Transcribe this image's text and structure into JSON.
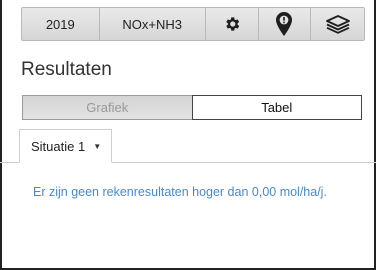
{
  "toolbar": {
    "year_label": "2019",
    "substance_label": "NOx+NH3",
    "icons": [
      "gear-icon",
      "map-marker-icon",
      "layers-icon"
    ]
  },
  "page": {
    "title": "Resultaten"
  },
  "view_toggle": {
    "options": [
      "Grafiek",
      "Tabel"
    ],
    "selected": "Tabel"
  },
  "tabs": {
    "active_label": "Situatie 1",
    "caret": "▼"
  },
  "results": {
    "message": "Er zijn geen rekenresultaten hoger dan 0,00 mol/ha/j."
  }
}
